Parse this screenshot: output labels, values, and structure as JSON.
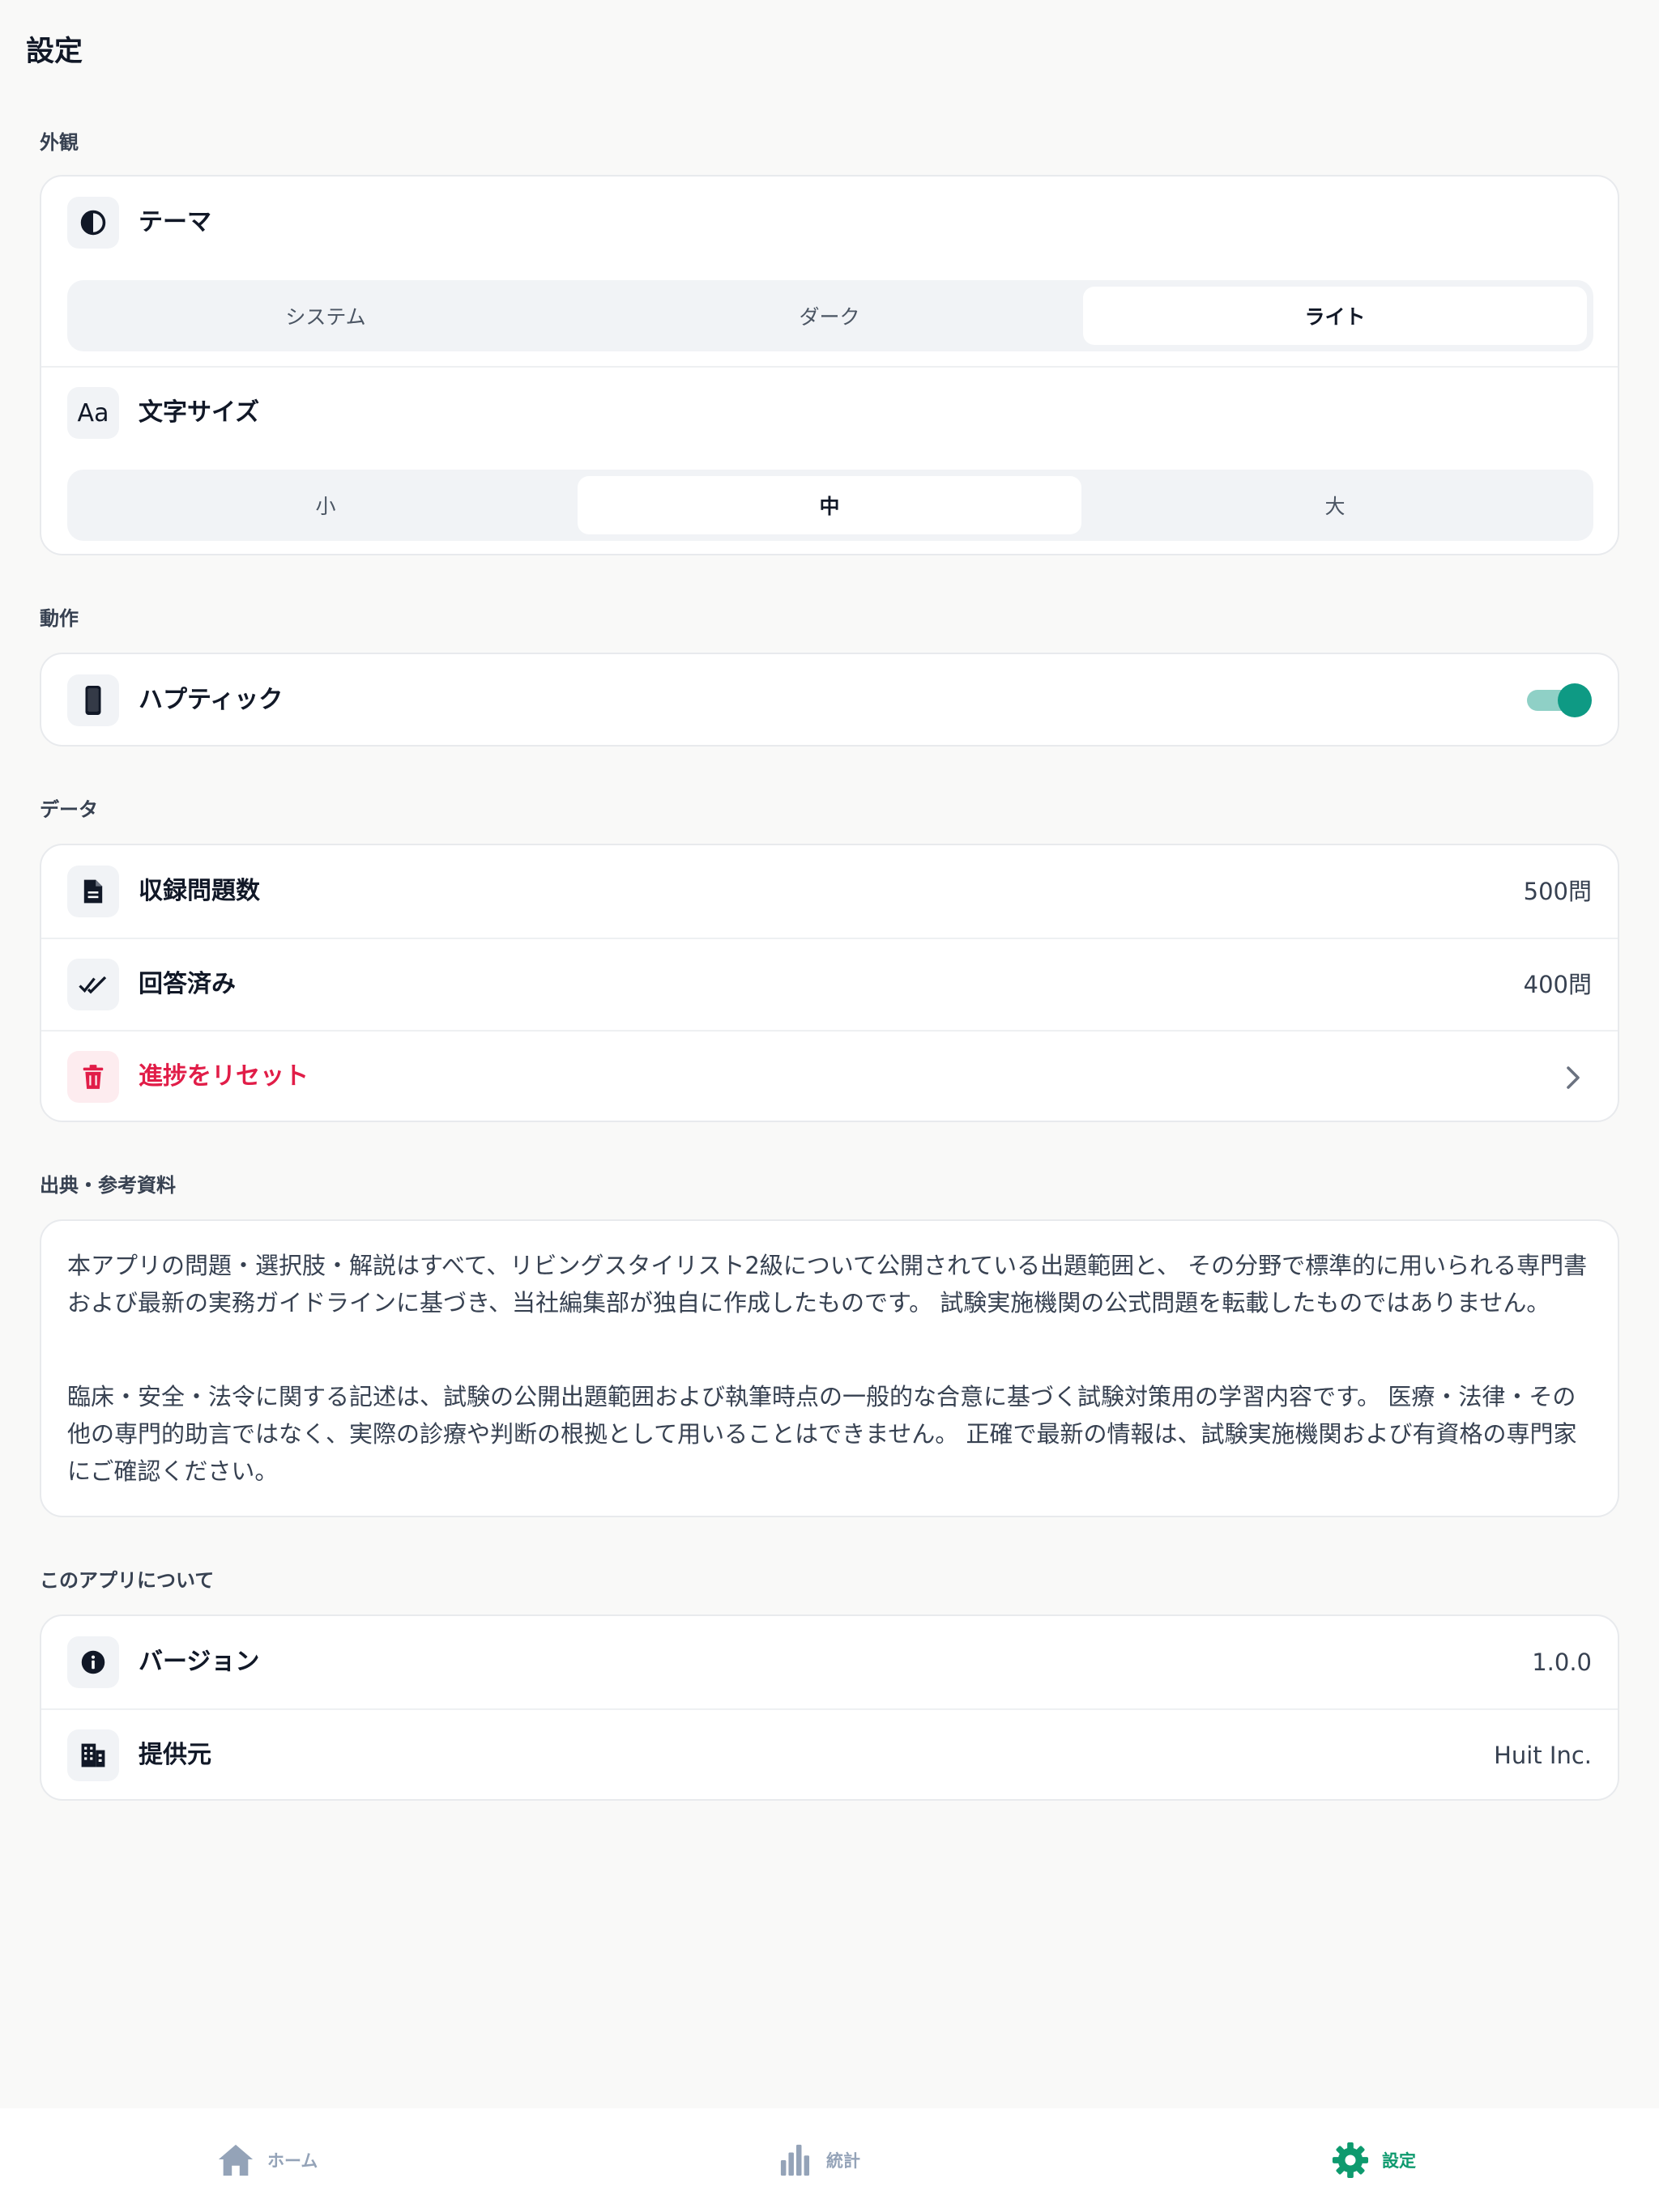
{
  "page": {
    "title": "設定"
  },
  "appearance": {
    "section_label": "外観",
    "theme": {
      "label": "テーマ",
      "icon": "contrast-icon",
      "options": [
        "システム",
        "ダーク",
        "ライト"
      ],
      "selected": "ライト"
    },
    "font_size": {
      "label": "文字サイズ",
      "icon_text": "Aa",
      "options": [
        "小",
        "中",
        "大"
      ],
      "selected": "中"
    }
  },
  "behavior": {
    "section_label": "動作",
    "haptic": {
      "label": "ハプティック",
      "icon": "smartphone-icon",
      "enabled": true
    }
  },
  "data": {
    "section_label": "データ",
    "total_questions": {
      "label": "収録問題数",
      "value": "500問",
      "icon": "document-icon"
    },
    "answered": {
      "label": "回答済み",
      "value": "400問",
      "icon": "double-check-icon"
    },
    "reset": {
      "label": "進捗をリセット",
      "icon": "trash-icon"
    }
  },
  "sources": {
    "section_label": "出典・参考資料",
    "paragraph_1": "本アプリの問題・選択肢・解説はすべて、リビングスタイリスト2級について公開されている出題範囲と、 その分野で標準的に用いられる専門書および最新の実務ガイドラインに基づき、当社編集部が独自に作成したものです。 試験実施機関の公式問題を転載したものではありません。",
    "paragraph_2": "臨床・安全・法令に関する記述は、試験の公開出題範囲および執筆時点の一般的な合意に基づく試験対策用の学習内容です。 医療・法律・その他の専門的助言ではなく、実際の診療や判断の根拠として用いることはできません。 正確で最新の情報は、試験実施機関および有資格の専門家にご確認ください。"
  },
  "about": {
    "section_label": "このアプリについて",
    "version": {
      "label": "バージョン",
      "value": "1.0.0",
      "icon": "info-icon"
    },
    "provider": {
      "label": "提供元",
      "value": "Huit Inc.",
      "icon": "building-icon"
    }
  },
  "tabbar": {
    "home": {
      "label": "ホーム",
      "icon": "home-icon"
    },
    "stats": {
      "label": "統計",
      "icon": "bar-chart-icon"
    },
    "settings": {
      "label": "設定",
      "icon": "gear-icon",
      "active": true
    }
  },
  "colors": {
    "accent": "#0e9a84",
    "danger": "#e11d48",
    "tab_inactive": "#94a3b8",
    "tab_active": "#0e9a6e"
  }
}
